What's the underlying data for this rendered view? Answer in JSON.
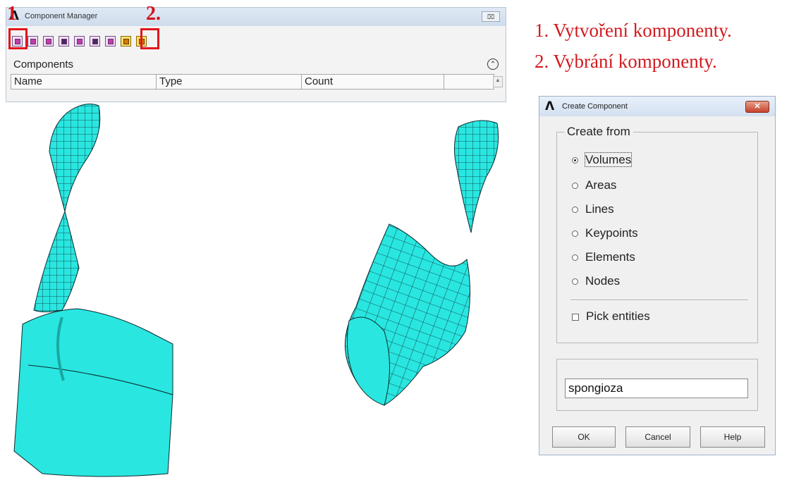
{
  "component_manager": {
    "title": "Component Manager",
    "close_symbol": "⌧",
    "section_label": "Components",
    "columns": [
      "Name",
      "Type",
      "Count"
    ],
    "toolbar_icons": [
      "create-component-icon",
      "icon-2",
      "icon-3",
      "icon-4",
      "icon-5",
      "icon-6",
      "icon-7",
      "select-component-icon",
      "icon-9"
    ],
    "markers": [
      "1",
      "2."
    ]
  },
  "caption": {
    "line1": "1. Vytvoření komponenty.",
    "line2": "2. Vybrání komponenty."
  },
  "create_component": {
    "title": "Create Component",
    "close_symbol": "✕",
    "group_label": "Create from",
    "options": [
      "Volumes",
      "Areas",
      "Lines",
      "Keypoints",
      "Elements",
      "Nodes"
    ],
    "selected_option": "Volumes",
    "pick_label": "Pick entities",
    "name_value": "spongioza",
    "buttons": {
      "ok": "OK",
      "cancel": "Cancel",
      "help": "Help"
    }
  },
  "colors": {
    "mesh": "#29e6e0",
    "mesh_lines": "#0b2b2f",
    "marker": "#e3141d",
    "caption": "#d11a1f"
  }
}
